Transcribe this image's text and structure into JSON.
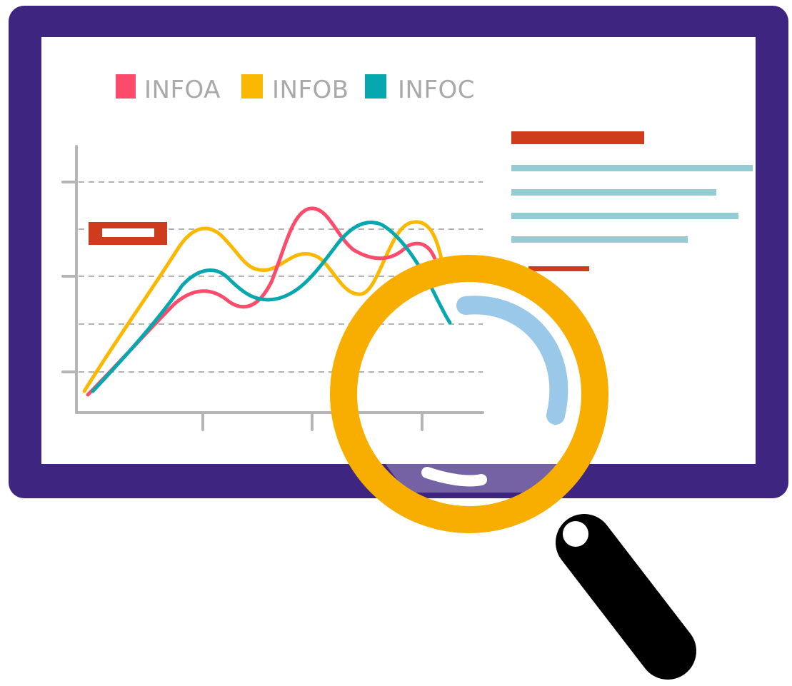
{
  "illustration": {
    "frame_color": "#3d2580",
    "screen_color": "#ffffff",
    "magnifier_ring_color": "#f7ae00",
    "magnifier_handle_color": "#000000",
    "lens_highlight_color": "#9ac8e8"
  },
  "legend": [
    {
      "label": "INFOA",
      "color": "#fd4b6b"
    },
    {
      "label": "INFOB",
      "color": "#fbb801"
    },
    {
      "label": "INFOC",
      "color": "#06a7af"
    }
  ],
  "chart_data": {
    "type": "line",
    "grid": true,
    "series": [
      {
        "name": "INFOA",
        "color": "#fd4b6b"
      },
      {
        "name": "INFOB",
        "color": "#fbb801"
      },
      {
        "name": "INFOC",
        "color": "#06a7af"
      }
    ]
  },
  "text_panel": {
    "heading_bar_color": "#cf3c1d",
    "line_color": "#94ccd4",
    "footer_bar_color": "#cf3c1d"
  }
}
